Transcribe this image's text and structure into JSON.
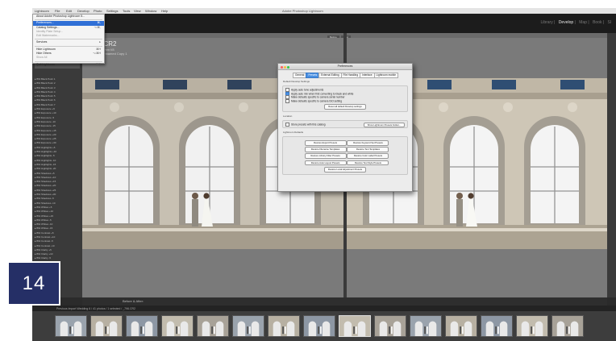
{
  "app": {
    "title": "Adobe Photoshop Lightroom",
    "menubar": [
      "Lightroom",
      "File",
      "Edit",
      "Develop",
      "Photo",
      "Settings",
      "Tools",
      "View",
      "Window",
      "Help"
    ],
    "modules": [
      "Library",
      "Develop",
      "Map",
      "Book",
      "Sl"
    ],
    "active_module": "Develop"
  },
  "lightroom_menu": {
    "items": [
      {
        "label": "About Adobe Photoshop Lightroom 5...",
        "shortcut": "",
        "state": "normal"
      },
      {
        "label": "Preferences...",
        "shortcut": "⌘,",
        "state": "highlight"
      },
      {
        "label": "Catalog Settings...",
        "shortcut": "⌥⌘,",
        "state": "normal"
      },
      {
        "label": "Identity Plate Setup...",
        "shortcut": "",
        "state": "disabled"
      },
      {
        "label": "Edit Watermarks...",
        "shortcut": "",
        "state": "disabled"
      },
      {
        "label": "Services",
        "shortcut": "▸",
        "state": "normal"
      },
      {
        "label": "Hide Lightroom",
        "shortcut": "⌘H",
        "state": "normal"
      },
      {
        "label": "Hide Others",
        "shortcut": "⌥⌘H",
        "state": "normal"
      },
      {
        "label": "Show All",
        "shortcut": "",
        "state": "disabled"
      },
      {
        "label": "Quit Lightroom",
        "shortcut": "⌘Q",
        "state": "normal"
      }
    ]
  },
  "photo": {
    "filename": "_796-CR2",
    "meta_line1": "ISO 200  35 mm  f/8",
    "meta_line2": "1/160 sec  Unnamed Copy 1",
    "before_label": "Before",
    "after_label": "After"
  },
  "presets": {
    "items": [
      "▸ BW Black Point 1",
      "▸ BW Black Point 2",
      "▸ BW Black Point 3",
      "▸ BW Black Point 4",
      "▸ BW Black Point 5",
      "▸ BW Black Point 6",
      "▸ BW Black Point 7",
      "▸ BW Exposure +5",
      "▸ BW Exposure +10",
      "▸ BW Exposure -5",
      "▸ BW Exposure -10",
      "▸ BW Exposure -15",
      "▸ BW Exposure +15",
      "▸ BW Exposure +20",
      "▸ BW Exposure +25",
      "▸ BW Exposure +30",
      "▸ BW Highlights +5",
      "▸ BW Highlights +10",
      "▸ BW Highlights -5",
      "▸ BW Highlights -10",
      "▸ BW Highlights -15",
      "▸ BW Highlights -20",
      "▸ BW Shadows +5",
      "▸ BW Shadows +10",
      "▸ BW Shadows +15",
      "▸ BW Shadows +20",
      "▸ BW Shadows +25",
      "▸ BW Shadows +30",
      "▸ BW Shadows -5",
      "▸ BW Shadows -10",
      "▸ BW Whites +5",
      "▸ BW Whites +10",
      "▸ BW Whites +15",
      "▸ BW Whites -5",
      "▸ BW Whites -10",
      "▸ BW Whites -15",
      "▸ BW Contrast +5",
      "▸ BW Contrast +10",
      "▸ BW Contrast -5",
      "▸ BW Contrast -10",
      "▸ BW Clarity +5",
      "▸ BW Clarity +10",
      "▸ BW Clarity -5",
      "▸ BW Clarity -10",
      "▸ BW Grain 1",
      "▸ BW Grain 2"
    ]
  },
  "preferences_dialog": {
    "title": "Preferences",
    "tabs": [
      "General",
      "Presets",
      "External Editing",
      "File Handling",
      "Interface",
      "Lightroom mobile"
    ],
    "active_tab": "Presets",
    "default_develop_title": "Default Develop Settings",
    "options": [
      {
        "label": "Apply auto tone adjustments",
        "checked": false
      },
      {
        "label": "Apply auto mix when first converting to black and white",
        "checked": true
      },
      {
        "label": "Make defaults specific to camera serial number",
        "checked": false
      },
      {
        "label": "Make defaults specific to camera ISO setting",
        "checked": false
      }
    ],
    "reset_button": "Reset all default Develop settings",
    "location_title": "Location",
    "store_presets_label": "Store presets with this catalog",
    "show_folder_button": "Show Lightroom Presets Folder...",
    "defaults_title": "Lightroom Defaults",
    "restore_left": [
      "Restore Export Presets",
      "Restore Filename Templates",
      "Restore Library Filter Presets",
      "Restore Auto Layout Presets"
    ],
    "restore_right": [
      "Restore Keyword Set Presets",
      "Restore Text Templates",
      "Restore Color Label Presets",
      "Restore Text Style Presets"
    ],
    "restore_bottom": "Restore Local Adjustment Presets"
  },
  "toolbar": {
    "text": "Before & After:"
  },
  "filmbar": {
    "path": "Previous Import   Wedding 6 / 41 photos / 1 selected / _796.CR2"
  },
  "filmstrip": {
    "count": 15
  },
  "badge": {
    "number": "14",
    "color": "#252f66"
  }
}
